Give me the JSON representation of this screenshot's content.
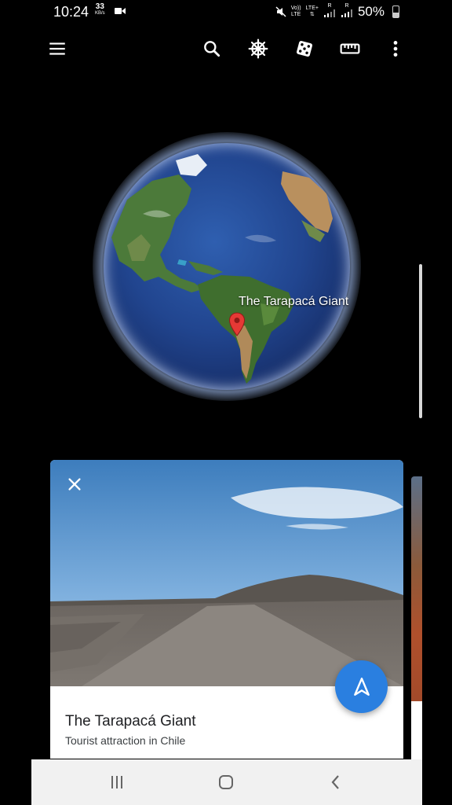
{
  "status_bar": {
    "time": "10:24",
    "data_speed_value": "33",
    "data_speed_unit": "KB/s",
    "network_volte": "Vo))",
    "network_lte": "LTE",
    "network_lte_plus": "LTE+",
    "roaming_1": "R",
    "roaming_2": "R",
    "battery_text": "50%",
    "battery_level": 0.5
  },
  "toolbar": {
    "icons": [
      "menu-icon",
      "search-icon",
      "voyager-wheel-icon",
      "dice-icon",
      "ruler-icon",
      "more-vert-icon"
    ]
  },
  "globe": {
    "place_label": "The Tarapacá Giant",
    "pin_color": "#e53935"
  },
  "card": {
    "title": "The Tarapacá Giant",
    "subtitle": "Tourist attraction in Chile",
    "fab_color": "#2a7fe0"
  },
  "nav_bar": {
    "icons": [
      "recents-icon",
      "home-icon",
      "back-icon"
    ]
  }
}
